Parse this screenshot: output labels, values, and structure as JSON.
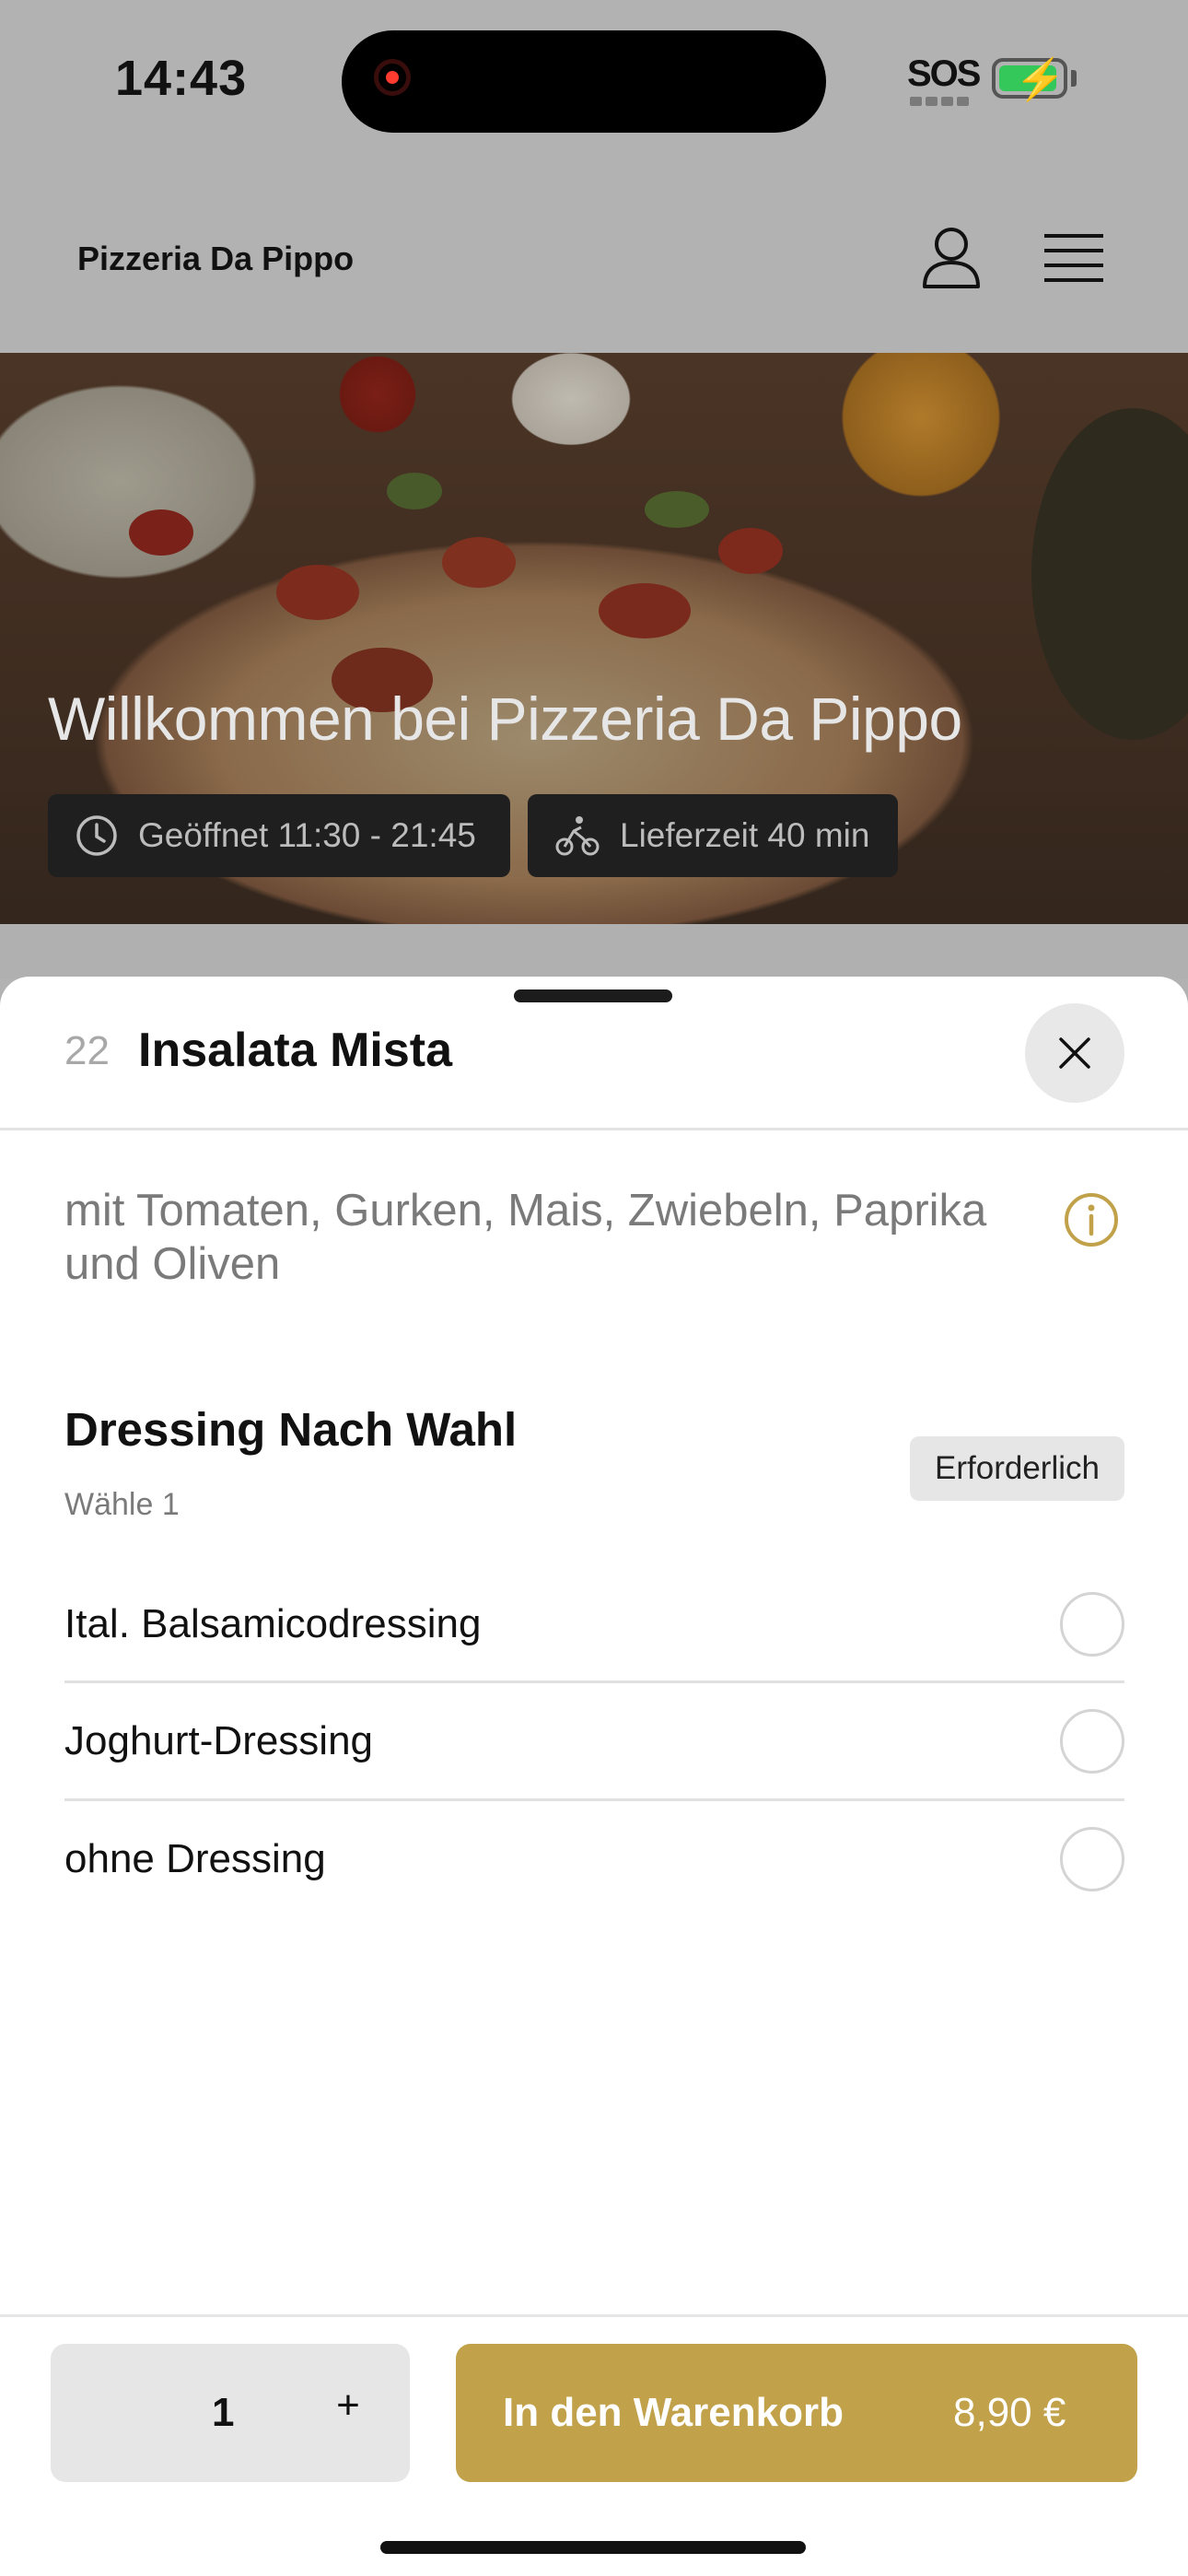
{
  "status_bar": {
    "time": "14:43",
    "carrier": "SOS"
  },
  "header": {
    "title": "Pizzeria Da Pippo"
  },
  "hero": {
    "title": "Willkommen bei Pizzeria Da Pippo",
    "opening_hours": "Geöffnet 11:30 - 21:45",
    "delivery_time": "Lieferzeit 40 min"
  },
  "item": {
    "number": "22",
    "name": "Insalata Mista",
    "description": "mit Tomaten, Gurken, Mais, Zwiebeln, Paprika und Oliven"
  },
  "option_group": {
    "title": "Dressing Nach Wahl",
    "subtitle": "Wähle 1",
    "badge": "Erforderlich",
    "options": [
      {
        "label": "Ital. Balsamicodressing",
        "selected": false
      },
      {
        "label": "Joghurt-Dressing",
        "selected": false
      },
      {
        "label": "ohne Dressing",
        "selected": false
      }
    ]
  },
  "footer": {
    "quantity": "1",
    "plus": "+",
    "add_to_cart": "In den Warenkorb",
    "price": "8,90 €"
  },
  "colors": {
    "accent": "#c1a14a",
    "scrim": "#b2b2b2"
  }
}
